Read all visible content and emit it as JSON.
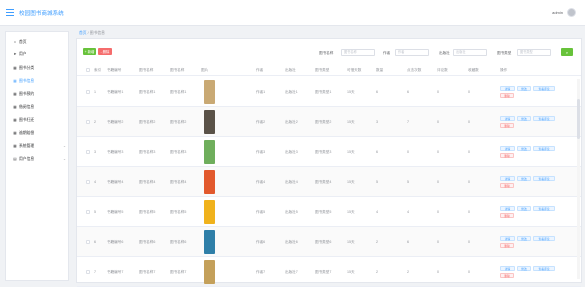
{
  "header": {
    "title": "校园图书商城系统",
    "user": "admin"
  },
  "sidebar": {
    "items": [
      {
        "label": "首页",
        "icon": "home-icon",
        "glyph": "⌂",
        "active": false
      },
      {
        "label": "用户",
        "icon": "user-icon",
        "glyph": "➤",
        "active": false
      },
      {
        "label": "图书分类",
        "icon": "grid-icon",
        "glyph": "▦",
        "active": false
      },
      {
        "label": "图书信息",
        "icon": "grid-icon",
        "glyph": "▦",
        "active": true
      },
      {
        "label": "图书预约",
        "icon": "grid-icon",
        "glyph": "▦",
        "active": false
      },
      {
        "label": "借阅信息",
        "icon": "grid-icon",
        "glyph": "▦",
        "active": false
      },
      {
        "label": "图书归还",
        "icon": "grid-icon",
        "glyph": "▦",
        "active": false
      },
      {
        "label": "逾期赔偿",
        "icon": "grid-icon",
        "glyph": "▦",
        "active": false
      },
      {
        "label": "系统管理",
        "icon": "grid-icon",
        "glyph": "▦",
        "active": false,
        "expandable": true
      },
      {
        "label": "用户信息",
        "icon": "calendar-icon",
        "glyph": "▤",
        "active": false,
        "expandable": true
      }
    ]
  },
  "breadcrumb": {
    "home": "首页",
    "current": "图书信息"
  },
  "toolbar": {
    "add_label": "+ 新增",
    "delete_label": "- 删除",
    "search_glyph": "⌕"
  },
  "filters": [
    {
      "label": "图书名称",
      "placeholder": "图书名称"
    },
    {
      "label": "作者",
      "placeholder": "作者"
    },
    {
      "label": "出版社",
      "placeholder": "出版社"
    },
    {
      "label": "图书类型",
      "placeholder": "图书类型"
    }
  ],
  "table": {
    "headers": [
      "索引",
      "书籍编号",
      "图书名称",
      "图书名称",
      "图片",
      "作者",
      "出版社",
      "图书类型",
      "可借天数",
      "数量",
      "点击次数",
      "评论数",
      "收藏数",
      "操作"
    ],
    "rows": [
      {
        "index": "1",
        "code": "书籍编号1",
        "name": "图书名称1",
        "name2": "图书名称1",
        "author": "作者1",
        "publisher": "出版社1",
        "type": "图书类型1",
        "days": "15天",
        "qty": "6",
        "clicks": "6",
        "comments": "0",
        "favs": "0",
        "cover": "#c9a974"
      },
      {
        "index": "2",
        "code": "书籍编号2",
        "name": "图书名称2",
        "name2": "图书名称2",
        "author": "作者2",
        "publisher": "出版社2",
        "type": "图书类型2",
        "days": "15天",
        "qty": "3",
        "clicks": "7",
        "comments": "0",
        "favs": "0",
        "cover": "#5a5248"
      },
      {
        "index": "3",
        "code": "书籍编号3",
        "name": "图书名称3",
        "name2": "图书名称3",
        "author": "作者3",
        "publisher": "出版社3",
        "type": "图书类型3",
        "days": "15天",
        "qty": "6",
        "clicks": "0",
        "comments": "0",
        "favs": "0",
        "cover": "#6fae5c"
      },
      {
        "index": "4",
        "code": "书籍编号4",
        "name": "图书名称4",
        "name2": "图书名称4",
        "author": "作者4",
        "publisher": "出版社4",
        "type": "图书类型4",
        "days": "15天",
        "qty": "5",
        "clicks": "5",
        "comments": "0",
        "favs": "0",
        "cover": "#e2592d"
      },
      {
        "index": "5",
        "code": "书籍编号5",
        "name": "图书名称5",
        "name2": "图书名称5",
        "author": "作者5",
        "publisher": "出版社5",
        "type": "图书类型5",
        "days": "15天",
        "qty": "4",
        "clicks": "4",
        "comments": "0",
        "favs": "0",
        "cover": "#f0b21c"
      },
      {
        "index": "6",
        "code": "书籍编号6",
        "name": "图书名称6",
        "name2": "图书名称6",
        "author": "作者6",
        "publisher": "出版社6",
        "type": "图书类型6",
        "days": "15天",
        "qty": "2",
        "clicks": "6",
        "comments": "0",
        "favs": "0",
        "cover": "#2f7fa8"
      },
      {
        "index": "7",
        "code": "书籍编号7",
        "name": "图书名称7",
        "name2": "图书名称7",
        "author": "作者7",
        "publisher": "出版社7",
        "type": "图书类型7",
        "days": "15天",
        "qty": "2",
        "clicks": "2",
        "comments": "0",
        "favs": "0",
        "cover": "#c4a05a"
      }
    ],
    "actions": {
      "detail": "详情",
      "edit": "修改",
      "comment": "查看评论",
      "delete": "删除"
    }
  },
  "colors": {
    "accent": "#409eff",
    "success": "#67c23a",
    "danger": "#f56c6c"
  }
}
